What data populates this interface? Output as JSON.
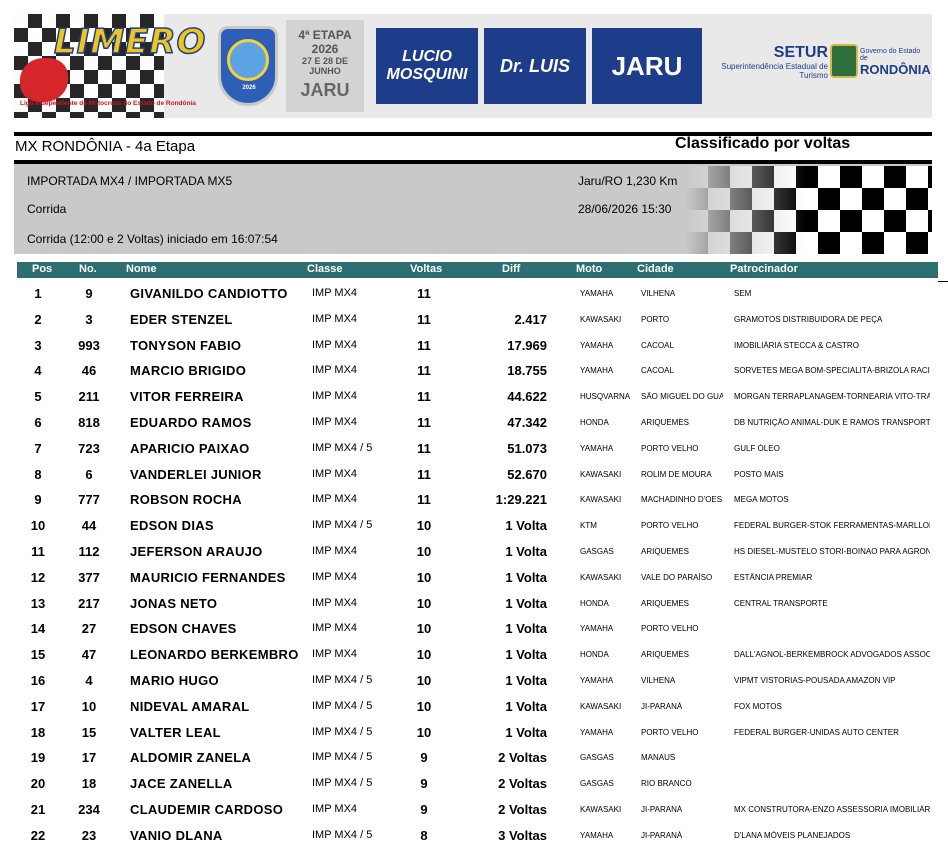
{
  "banner": {
    "logo_text": "LIMERO",
    "logo_tagline": "Liga Independente de Motocross do Estado de Rondônia",
    "emblem_year": "2026",
    "etapa_line1": "4ª ETAPA",
    "etapa_line2": "2026",
    "etapa_line3": "27 E 28 DE JUNHO",
    "etapa_line4": "JARU",
    "sponsor1": "LUCIO MOSQUINI",
    "sponsor2": "Dr. LUIS",
    "sponsor3": "JARU",
    "setur_title": "SETUR",
    "setur_subtitle": "Superintendência Estadual de Turismo",
    "gov_line1": "Governo do Estado de",
    "gov_line2": "RONDÔNIA"
  },
  "header": {
    "event_title": "MX RONDÔNIA - 4a Etapa",
    "classification": "Classificado por voltas"
  },
  "info": {
    "categories": "IMPORTADA MX4 / IMPORTADA MX5",
    "session": "Corrida",
    "start_info": "Corrida (12:00 e 2 Voltas) iniciado em 16:07:54",
    "location": "Jaru/RO 1,230 Km",
    "datetime": "28/06/2026 15:30"
  },
  "columns": {
    "pos": "Pos",
    "no": "No.",
    "nome": "Nome",
    "classe": "Classe",
    "voltas": "Voltas",
    "diff": "Diff",
    "moto": "Moto",
    "cidade": "Cidade",
    "patrocinador": "Patrocinador"
  },
  "rows": [
    {
      "pos": "1",
      "no": "9",
      "nome": "GIVANILDO CANDIOTTO",
      "classe": "IMP MX4",
      "voltas": "11",
      "diff": "",
      "moto": "YAMAHA",
      "cidade": "VILHENA",
      "patro": "SEM"
    },
    {
      "pos": "2",
      "no": "3",
      "nome": "EDER STENZEL",
      "classe": "IMP MX4",
      "voltas": "11",
      "diff": "2.417",
      "moto": "KAWASAKI",
      "cidade": "PORTO",
      "patro": "GRAMOTOS DISTRIBUIDORA DE PEÇA"
    },
    {
      "pos": "3",
      "no": "993",
      "nome": "TONYSON FABIO",
      "classe": "IMP MX4",
      "voltas": "11",
      "diff": "17.969",
      "moto": "YAMAHA",
      "cidade": "CACOAL",
      "patro": "IMOBILIÁRIA STECCA & CASTRO"
    },
    {
      "pos": "4",
      "no": "46",
      "nome": "MARCIO BRIGIDO",
      "classe": "IMP MX4",
      "voltas": "11",
      "diff": "18.755",
      "moto": "YAMAHA",
      "cidade": "CACOAL",
      "patro": "SORVETES MEGA BOM-SPECIALITÁ-BRIZOLA RACING"
    },
    {
      "pos": "5",
      "no": "211",
      "nome": "VITOR FERREIRA",
      "classe": "IMP MX4",
      "voltas": "11",
      "diff": "44.622",
      "moto": "HUSQVARNA",
      "cidade": "SÃO MIGUEL DO GUA",
      "patro": "MORGAN TERRAPLANAGEM-TORNEARIA VITO-TRATOR"
    },
    {
      "pos": "6",
      "no": "818",
      "nome": "EDUARDO RAMOS",
      "classe": "IMP MX4",
      "voltas": "11",
      "diff": "47.342",
      "moto": "HONDA",
      "cidade": "ARIQUEMES",
      "patro": "DB NUTRIÇÃO ANIMAL-DUK E RAMOS TRANSPORTES"
    },
    {
      "pos": "7",
      "no": "723",
      "nome": "APARICIO PAIXAO",
      "classe": "IMP MX4 / 5",
      "voltas": "11",
      "diff": "51.073",
      "moto": "YAMAHA",
      "cidade": "PORTO VELHO",
      "patro": "GULF ÓLEO"
    },
    {
      "pos": "8",
      "no": "6",
      "nome": "VANDERLEI JUNIOR",
      "classe": "IMP MX4",
      "voltas": "11",
      "diff": "52.670",
      "moto": "KAWASAKI",
      "cidade": "ROLIM DE MOURA",
      "patro": "POSTO MAIS"
    },
    {
      "pos": "9",
      "no": "777",
      "nome": "ROBSON ROCHA",
      "classe": "IMP MX4",
      "voltas": "11",
      "diff": "1:29.221",
      "moto": "KAWASAKI",
      "cidade": "MACHADINHO D'OES",
      "patro": "MEGA MOTOS"
    },
    {
      "pos": "10",
      "no": "44",
      "nome": "EDSON DIAS",
      "classe": "IMP MX4 / 5",
      "voltas": "10",
      "diff": "1 Volta",
      "moto": "KTM",
      "cidade": "PORTO VELHO",
      "patro": "FEDERAL BURGER-STOK FERRAMENTAS-MARLLON RACING"
    },
    {
      "pos": "11",
      "no": "112",
      "nome": "JEFERSON ARAUJO",
      "classe": "IMP MX4",
      "voltas": "10",
      "diff": "1 Volta",
      "moto": "GASGAS",
      "cidade": "ARIQUEMES",
      "patro": "HS DIESEL-MUSTELO STORI-BOINAO PARA AGRONEGOCIO"
    },
    {
      "pos": "12",
      "no": "377",
      "nome": "MAURICIO FERNANDES",
      "classe": "IMP MX4",
      "voltas": "10",
      "diff": "1 Volta",
      "moto": "KAWASAKI",
      "cidade": "VALE DO PARAÍSO",
      "patro": "ESTÂNCIA PREMIAR"
    },
    {
      "pos": "13",
      "no": "217",
      "nome": "JONAS NETO",
      "classe": "IMP MX4",
      "voltas": "10",
      "diff": "1 Volta",
      "moto": "HONDA",
      "cidade": "ARIQUEMES",
      "patro": "CENTRAL TRANSPORTE"
    },
    {
      "pos": "14",
      "no": "27",
      "nome": "EDSON CHAVES",
      "classe": "IMP MX4",
      "voltas": "10",
      "diff": "1 Volta",
      "moto": "YAMAHA",
      "cidade": "PORTO VELHO",
      "patro": ""
    },
    {
      "pos": "15",
      "no": "47",
      "nome": "LEONARDO BERKEMBRO",
      "classe": "IMP MX4",
      "voltas": "10",
      "diff": "1 Volta",
      "moto": "HONDA",
      "cidade": "ARIQUEMES",
      "patro": "DALL'AGNOL-BERKEMBROCK ADVOGADOS ASSOCIADOS"
    },
    {
      "pos": "16",
      "no": "4",
      "nome": "MARIO HUGO",
      "classe": "IMP MX4 / 5",
      "voltas": "10",
      "diff": "1 Volta",
      "moto": "YAMAHA",
      "cidade": "VILHENA",
      "patro": "VIPMT VISTORIAS-POUSADA AMAZON VIP"
    },
    {
      "pos": "17",
      "no": "10",
      "nome": "NIDEVAL AMARAL",
      "classe": "IMP MX4 / 5",
      "voltas": "10",
      "diff": "1 Volta",
      "moto": "KAWASAKI",
      "cidade": "JI-PARANÁ",
      "patro": "FOX MOTOS"
    },
    {
      "pos": "18",
      "no": "15",
      "nome": "VALTER LEAL",
      "classe": "IMP MX4 / 5",
      "voltas": "10",
      "diff": "1 Volta",
      "moto": "YAMAHA",
      "cidade": "PORTO VELHO",
      "patro": "FEDERAL BURGER-UNIDAS AUTO CENTER"
    },
    {
      "pos": "19",
      "no": "17",
      "nome": "ALDOMIR ZANELA",
      "classe": "IMP MX4 / 5",
      "voltas": "9",
      "diff": "2 Voltas",
      "moto": "GASGAS",
      "cidade": "MANAUS",
      "patro": ""
    },
    {
      "pos": "20",
      "no": "18",
      "nome": "JACE ZANELLA",
      "classe": "IMP MX4 / 5",
      "voltas": "9",
      "diff": "2 Voltas",
      "moto": "GASGAS",
      "cidade": "RIO BRANCO",
      "patro": ""
    },
    {
      "pos": "21",
      "no": "234",
      "nome": "CLAUDEMIR CARDOSO",
      "classe": "IMP MX4",
      "voltas": "9",
      "diff": "2 Voltas",
      "moto": "KAWASAKI",
      "cidade": "JI-PARANÁ",
      "patro": "MX CONSTRUTORA-ENZO ASSESSORIA IMOBILIÁRIA"
    },
    {
      "pos": "22",
      "no": "23",
      "nome": "VANIO DLANA",
      "classe": "IMP MX4 / 5",
      "voltas": "8",
      "diff": "3 Voltas",
      "moto": "YAMAHA",
      "cidade": "JI-PARANÁ",
      "patro": "D'LANA MÓVEIS PLANEJADOS"
    }
  ]
}
